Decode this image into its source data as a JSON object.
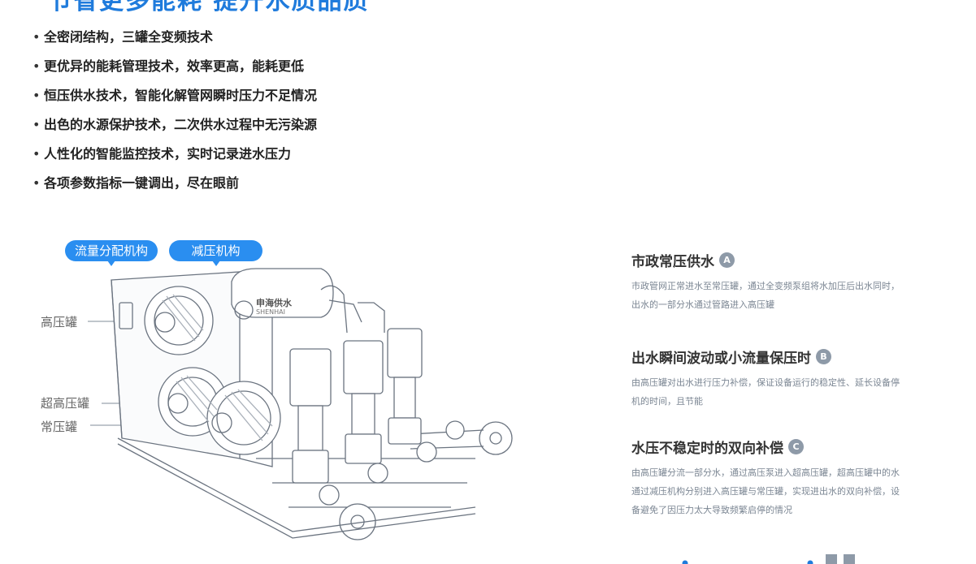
{
  "headline": "节省更多能耗  提升水质品质",
  "features": [
    "全密闭结构，三罐全变频技术",
    "更优异的能耗管理技术，效率更高，能耗更低",
    "恒压供水技术，智能化解管网瞬时压力不足情况",
    "出色的水源保护技术，二次供水过程中无污染源",
    "人性化的智能监控技术，实时记录进水压力",
    "各项参数指标一键调出，尽在眼前"
  ],
  "bubbles": {
    "flow": "流量分配机构",
    "pressure": "减压机构"
  },
  "tank_labels": {
    "high": "高压罐",
    "super_high": "超高压罐",
    "normal": "常压罐"
  },
  "brand": {
    "cn": "申海供水",
    "en": "SHENHAI"
  },
  "info_blocks": [
    {
      "title": "市政常压供水",
      "badge": "A",
      "text": "市政管网正常进水至常压罐，通过全变频泵组将水加压后出水同时，出水的一部分水通过管路进入高压罐"
    },
    {
      "title": "出水瞬间波动或小流量保压时",
      "badge": "B",
      "text": "由高压罐对出水进行压力补偿，保证设备运行的稳定性、延长设备停机的时间，且节能"
    },
    {
      "title": "水压不稳定时的双向补偿",
      "badge": "C",
      "text": "由高压罐分流一部分水，通过高压泵进入超高压罐，超高压罐中的水通过减压机构分别进入高压罐与常压罐，实现进出水的双向补偿，设备避免了因压力太大导致频繁启停的情况"
    }
  ],
  "colors": {
    "accent": "#1f7bdc",
    "bubble": "#2a8ef0",
    "badge": "#8e9aa8",
    "line": "#6b7480"
  }
}
